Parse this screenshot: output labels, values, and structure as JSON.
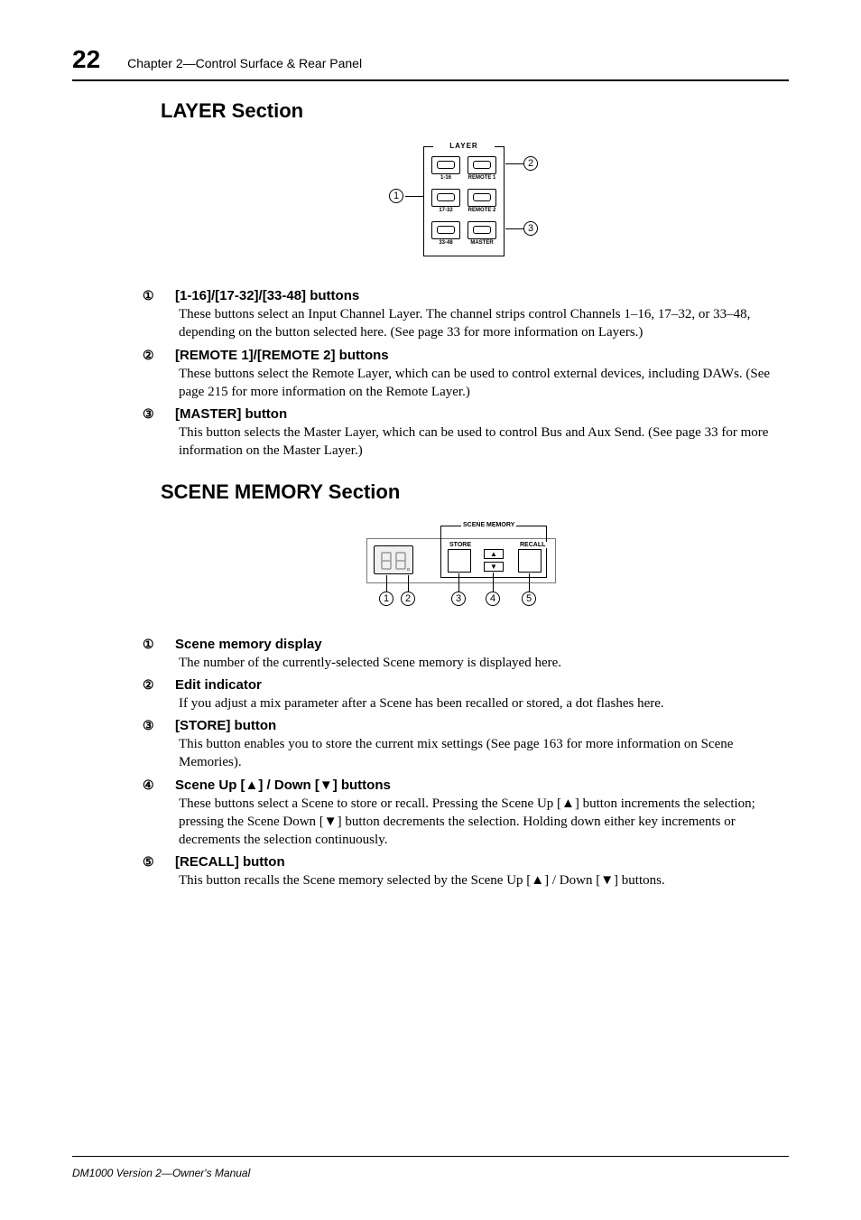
{
  "header": {
    "page_number": "22",
    "chapter": "Chapter 2—Control Surface & Rear Panel"
  },
  "section1": {
    "title": "LAYER Section",
    "diagram": {
      "title": "LAYER",
      "labels": {
        "r1l": "1-16",
        "r1r": "REMOTE 1",
        "r2l": "17-32",
        "r2r": "REMOTE 2",
        "r3l": "33-48",
        "r3r": "MASTER"
      },
      "callouts": {
        "c1": "1",
        "c2": "2",
        "c3": "3"
      }
    },
    "items": [
      {
        "num": "①",
        "title": "[1-16]/[17-32]/[33-48] buttons",
        "body": "These buttons select an Input Channel Layer. The channel strips control Channels 1–16, 17–32, or 33–48, depending on the button selected here. (See page 33 for more information on Layers.)"
      },
      {
        "num": "②",
        "title": "[REMOTE 1]/[REMOTE 2] buttons",
        "body": "These buttons select the Remote Layer, which can be used to control external devices, including DAWs. (See page 215 for more information on the Remote Layer.)"
      },
      {
        "num": "③",
        "title": "[MASTER] button",
        "body": "This button selects the Master Layer, which can be used to control Bus and Aux Send. (See page 33 for more information on the Master Layer.)"
      }
    ]
  },
  "section2": {
    "title": "SCENE MEMORY Section",
    "diagram": {
      "title": "SCENE MEMORY",
      "labels": {
        "store": "STORE",
        "recall": "RECALL"
      },
      "callouts": {
        "c1": "1",
        "c2": "2",
        "c3": "3",
        "c4": "4",
        "c5": "5"
      }
    },
    "items": [
      {
        "num": "①",
        "title": "Scene memory display",
        "body": "The number of the currently-selected Scene memory is displayed here."
      },
      {
        "num": "②",
        "title": "Edit indicator",
        "body": "If you adjust a mix parameter after a Scene has been recalled or stored, a dot flashes here."
      },
      {
        "num": "③",
        "title": "[STORE] button",
        "body": "This button enables you to store the current mix settings (See page 163 for more information on Scene Memories)."
      },
      {
        "num": "④",
        "title": "Scene Up [▲] / Down [▼] buttons",
        "body": "These buttons select a Scene to store or recall. Pressing the Scene Up [▲] button increments the selection; pressing the Scene Down [▼] button decrements the selection. Holding down either key increments or decrements the selection continuously."
      },
      {
        "num": "⑤",
        "title": "[RECALL] button",
        "body": "This button recalls the Scene memory selected by the Scene Up [▲] / Down [▼] buttons."
      }
    ]
  },
  "footer": "DM1000 Version 2—Owner's Manual"
}
